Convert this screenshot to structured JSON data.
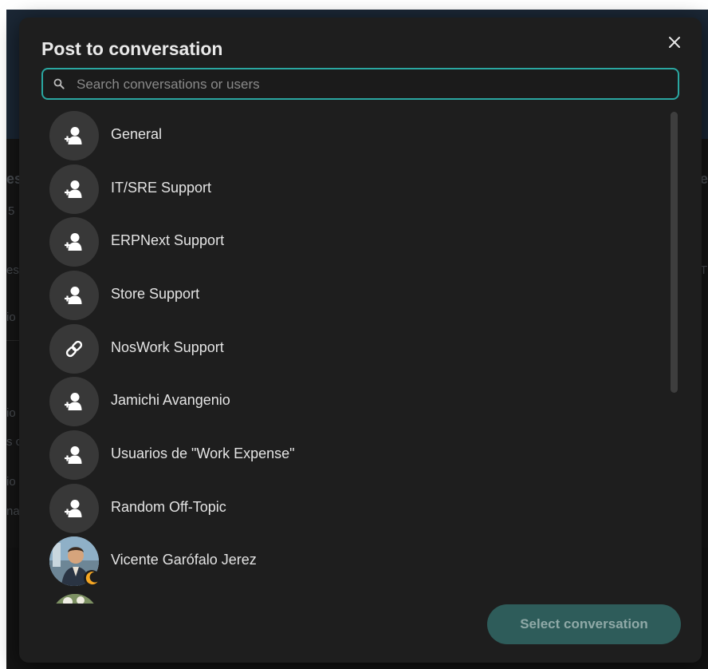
{
  "background": {
    "fragments": [
      "es",
      "5",
      "es",
      "io",
      "io",
      "s c",
      "io",
      "na",
      "e",
      "T"
    ]
  },
  "modal": {
    "title": "Post to conversation",
    "search": {
      "placeholder": "Search conversations or users",
      "value": ""
    },
    "conversations": [
      {
        "label": "General",
        "icon": "group-icon"
      },
      {
        "label": "IT/SRE Support",
        "icon": "group-icon"
      },
      {
        "label": "ERPNext Support",
        "icon": "group-icon"
      },
      {
        "label": "Store Support",
        "icon": "group-icon"
      },
      {
        "label": "NosWork Support",
        "icon": "link-icon"
      },
      {
        "label": "Jamichi Avangenio",
        "icon": "group-icon"
      },
      {
        "label": "Usuarios de \"Work Expense\"",
        "icon": "group-icon"
      },
      {
        "label": "Random Off-Topic",
        "icon": "group-icon"
      },
      {
        "label": "Vicente Garófalo Jerez",
        "icon": "user-photo",
        "status": "away"
      }
    ],
    "select_button": "Select conversation"
  },
  "colors": {
    "accent": "#2aa7a1",
    "modal_bg": "#1e1e1e",
    "avatar_bg": "#383838",
    "away_status": "#f5a623"
  }
}
